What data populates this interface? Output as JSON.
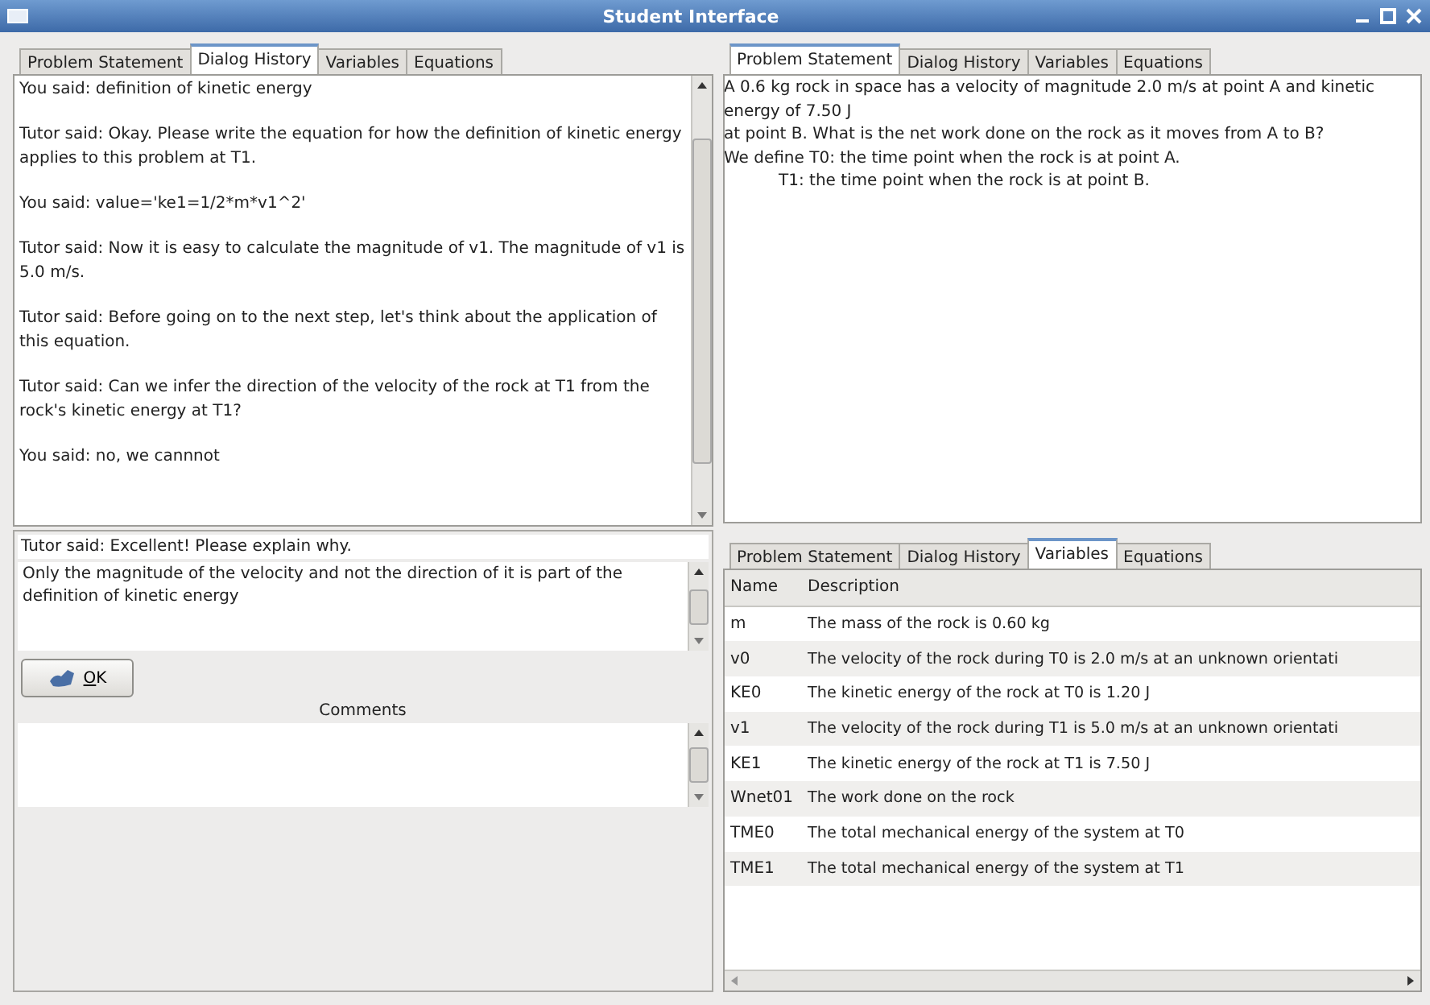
{
  "window": {
    "title": "Student Interface"
  },
  "dialog_panel": {
    "tabs": [
      {
        "label": "Problem Statement",
        "selected": false
      },
      {
        "label": "Dialog History",
        "selected": true
      },
      {
        "label": "Variables",
        "selected": false
      },
      {
        "label": "Equations",
        "selected": false
      }
    ],
    "messages": [
      "You said: definition of kinetic energy",
      "Tutor said: Okay. Please write the equation for how the definition of kinetic energy applies to this problem at T1.",
      "You said: value='ke1=1/2*m*v1^2'",
      "Tutor said:  Now it is easy to calculate the magnitude of v1. The magnitude of v1 is 5.0 m/s.",
      "Tutor said:  Before going on to the next step, let's think about the application of this equation.",
      "Tutor said:  Can we infer the direction of the velocity of the rock at T1 from the rock's kinetic energy at T1?",
      "You said: no, we cannnot"
    ]
  },
  "tutor_prompt": "Tutor said: Excellent! Please explain why.",
  "answer": {
    "value": "Only the magnitude of the velocity and not the direction of it is part of the definition of kinetic energy"
  },
  "ok_button": {
    "label": "OK"
  },
  "comments": {
    "label": "Comments"
  },
  "problem_panel": {
    "tabs": [
      {
        "label": "Problem Statement",
        "selected": true
      },
      {
        "label": "Dialog History",
        "selected": false
      },
      {
        "label": "Variables",
        "selected": false
      },
      {
        "label": "Equations",
        "selected": false
      }
    ],
    "lines": [
      {
        "text": "A 0.6 kg rock in space has a velocity of magnitude 2.0 m/s at point A and kinetic energy of 7.50 J",
        "indented": false
      },
      {
        "text": "at point B. What is the net work done on the rock as it moves from A to B?",
        "indented": false
      },
      {
        "text": "We define T0: the time point when the rock is at point A.",
        "indented": false
      },
      {
        "text": "T1: the time point when the rock is at point B.",
        "indented": true
      }
    ]
  },
  "variables_panel": {
    "tabs": [
      {
        "label": "Problem Statement",
        "selected": false
      },
      {
        "label": "Dialog History",
        "selected": false
      },
      {
        "label": "Variables",
        "selected": true
      },
      {
        "label": "Equations",
        "selected": false
      }
    ],
    "columns": [
      "Name",
      "Description"
    ],
    "rows": [
      [
        "m",
        "The mass of the rock is 0.60 kg"
      ],
      [
        "v0",
        "The velocity of the rock during T0 is 2.0 m/s at an unknown orientati"
      ],
      [
        "KE0",
        "The kinetic energy of the rock at T0 is 1.20 J"
      ],
      [
        "v1",
        "The velocity of the rock during T1 is 5.0 m/s at an unknown orientati"
      ],
      [
        "KE1",
        "The kinetic energy of the rock at T1 is 7.50 J"
      ],
      [
        "Wnet01",
        "The work done on the rock"
      ],
      [
        "TME0",
        "The total mechanical energy of the system at T0"
      ],
      [
        "TME1",
        "The total mechanical energy of the system at T1"
      ]
    ]
  }
}
